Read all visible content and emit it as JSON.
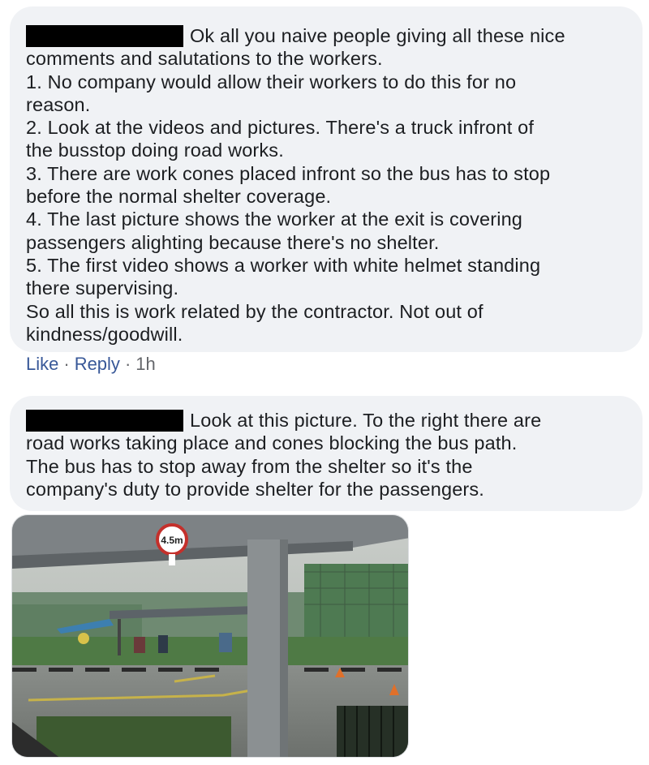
{
  "comment1": {
    "text": "Ok all you naive people giving all these nice\ncomments and salutations to the workers.\n1. No company would allow their workers to do this for no\nreason.\n2. Look at the videos and pictures. There's a truck infront of\nthe busstop doing road works.\n3. There are work cones placed infront so the bus has to stop\nbefore the normal shelter coverage.\n4. The last picture shows the worker at the exit is covering\npassengers alighting because there's no shelter.\n5. The first video shows a worker with white helmet standing\nthere supervising.\nSo all this is work related by the contractor. Not out of\nkindness/goodwill."
  },
  "actions": {
    "like": "Like",
    "separator": "·",
    "reply": "Reply",
    "time": "1h"
  },
  "comment2": {
    "text": "Look at this picture. To the right there are\nroad works taking place and cones blocking the bus path.\nThe bus has to stop away from the shelter so it's the\ncompany's duty to provide shelter for the passengers."
  },
  "photo": {
    "sign_text": "4.5m"
  },
  "colors": {
    "bubble": "#f0f2f5",
    "link": "#385898",
    "text": "#1c1e21",
    "meta": "#65676b"
  }
}
